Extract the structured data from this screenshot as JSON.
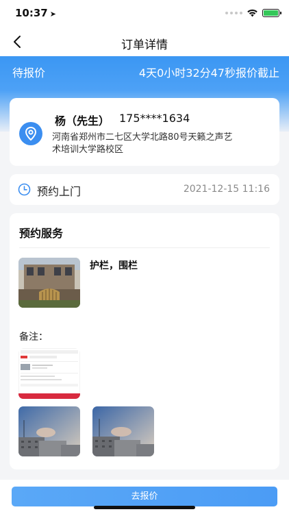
{
  "status_bar": {
    "time": "10:37",
    "location_arrow": "➤",
    "icons": [
      "signal-dots",
      "wifi-icon",
      "battery-charging-icon"
    ]
  },
  "nav": {
    "title": "订单详情",
    "back_icon": "chevron-left-icon"
  },
  "banner": {
    "status": "待报价",
    "deadline": "4天0小时32分47秒报价截止"
  },
  "contact": {
    "name": "杨（先生）",
    "phone": "175****1634",
    "address": "河南省郑州市二七区大学北路80号天籁之声艺术培训大学路校区",
    "icon": "location-pin-icon"
  },
  "appointment": {
    "label": "预约上门",
    "time": "2021-12-15 11:16",
    "icon": "clock-icon"
  },
  "service": {
    "title": "预约服务",
    "item_name": "护栏，围栏",
    "remark_label": "备注："
  },
  "bottom": {
    "quote_button": "去报价"
  },
  "colors": {
    "accent": "#3b8ef0",
    "banner": "#3b97f3",
    "background": "#f4f5f7"
  }
}
